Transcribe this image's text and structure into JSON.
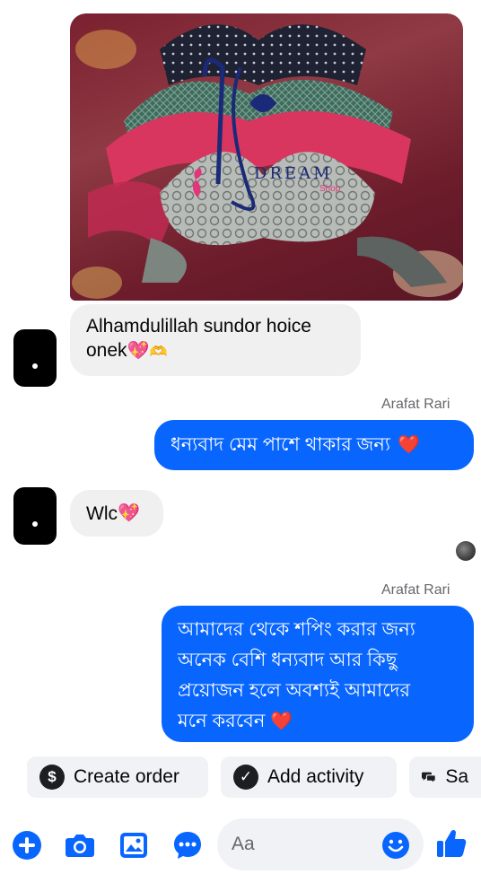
{
  "photo": {
    "logo_text": "DREAM",
    "logo_subtext": "Shop"
  },
  "messages": [
    {
      "direction": "incoming",
      "text_line1": "Alhamdulillah sundor hoice",
      "text_line2": "onek"
    },
    {
      "direction": "outgoing",
      "sender": "Arafat Rari",
      "text": "ধন্যবাদ মেম পাশে থাকার জন্য"
    },
    {
      "direction": "incoming",
      "text": "Wlc"
    },
    {
      "direction": "outgoing",
      "sender": "Arafat Rari",
      "lines": [
        "আমাদের থেকে শপিং করার জন্য",
        "অনেক বেশি ধন্যবাদ আর কিছু",
        "প্রয়োজন হলে অবশ্যই আমাদের",
        "মনে করবেন"
      ]
    }
  ],
  "quick_actions": [
    {
      "label": "Create order",
      "icon": "dollar-icon"
    },
    {
      "label": "Add activity",
      "icon": "check-icon"
    },
    {
      "label": "Sa",
      "icon": "chat-bubbles-icon"
    }
  ],
  "composer": {
    "placeholder": "Aa"
  },
  "colors": {
    "outgoing_bubble": "#0866ff",
    "incoming_bubble": "#f0f0f0",
    "accent": "#0866ff"
  }
}
